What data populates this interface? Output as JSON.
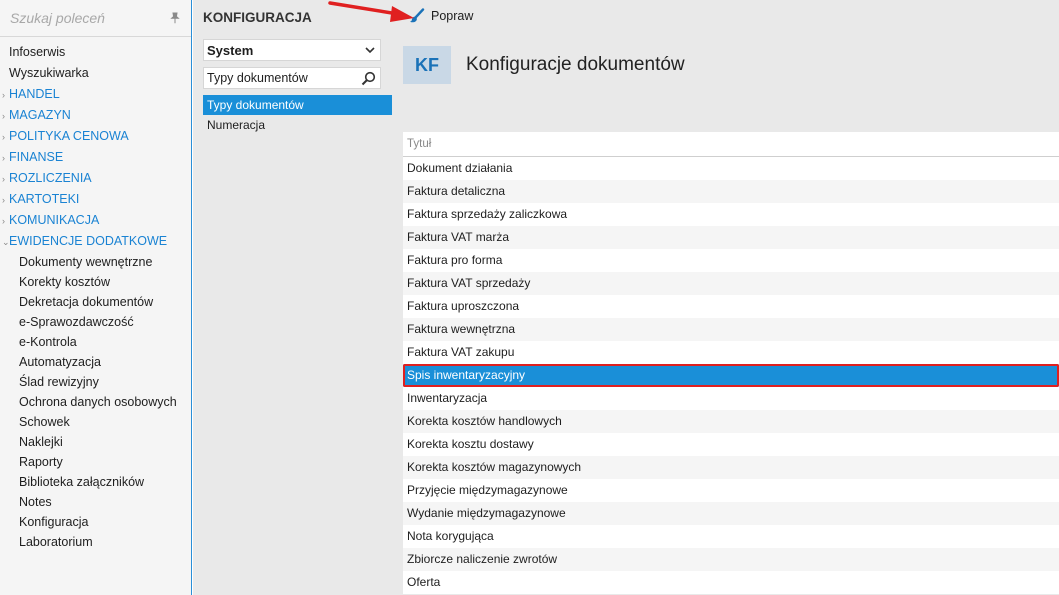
{
  "nav": {
    "search_placeholder": "Szukaj poleceń",
    "top_items": [
      "Infoserwis",
      "Wyszukiwarka"
    ],
    "sections": [
      "HANDEL",
      "MAGAZYN",
      "POLITYKA CENOWA",
      "FINANSE",
      "ROZLICZENIA",
      "KARTOTEKI",
      "KOMUNIKACJA"
    ],
    "open_section": "EWIDENCJE DODATKOWE",
    "sub_items": [
      "Dokumenty wewnętrzne",
      "Korekty kosztów",
      "Dekretacja dokumentów",
      "e-Sprawozdawczość",
      "e-Kontrola",
      "Automatyzacja",
      "Ślad rewizyjny",
      "Ochrona danych osobowych",
      "Schowek",
      "Naklejki",
      "Raporty",
      "Biblioteka załączników",
      "Notes",
      "Konfiguracja",
      "Laboratorium"
    ]
  },
  "mid": {
    "title": "KONFIGURACJA",
    "select_value": "System",
    "search_value": "Typy dokumentów",
    "items": [
      "Typy dokumentów",
      "Numeracja"
    ],
    "selected_index": 0
  },
  "toolbar": {
    "edit_label": "Popraw"
  },
  "content": {
    "badge": "KF",
    "title": "Konfiguracje dokumentów",
    "column_header": "Tytuł",
    "rows": [
      "Dokument działania",
      "Faktura detaliczna",
      "Faktura sprzedaży zaliczkowa",
      "Faktura VAT marża",
      "Faktura pro forma",
      "Faktura VAT sprzedaży",
      "Faktura uproszczona",
      "Faktura wewnętrzna",
      "Faktura VAT zakupu",
      "Spis inwentaryzacyjny",
      "Inwentaryzacja",
      "Korekta kosztów handlowych",
      "Korekta kosztu dostawy",
      "Korekta kosztów magazynowych",
      "Przyjęcie międzymagazynowe",
      "Wydanie międzymagazynowe",
      "Nota korygująca",
      "Zbiorcze naliczenie zwrotów",
      "Oferta"
    ],
    "selected_row": 9
  },
  "colors": {
    "accent": "#1a8fd8",
    "section_text": "#1a83d3",
    "highlight_border": "#e02020",
    "annotation_arrow": "#e02020"
  }
}
